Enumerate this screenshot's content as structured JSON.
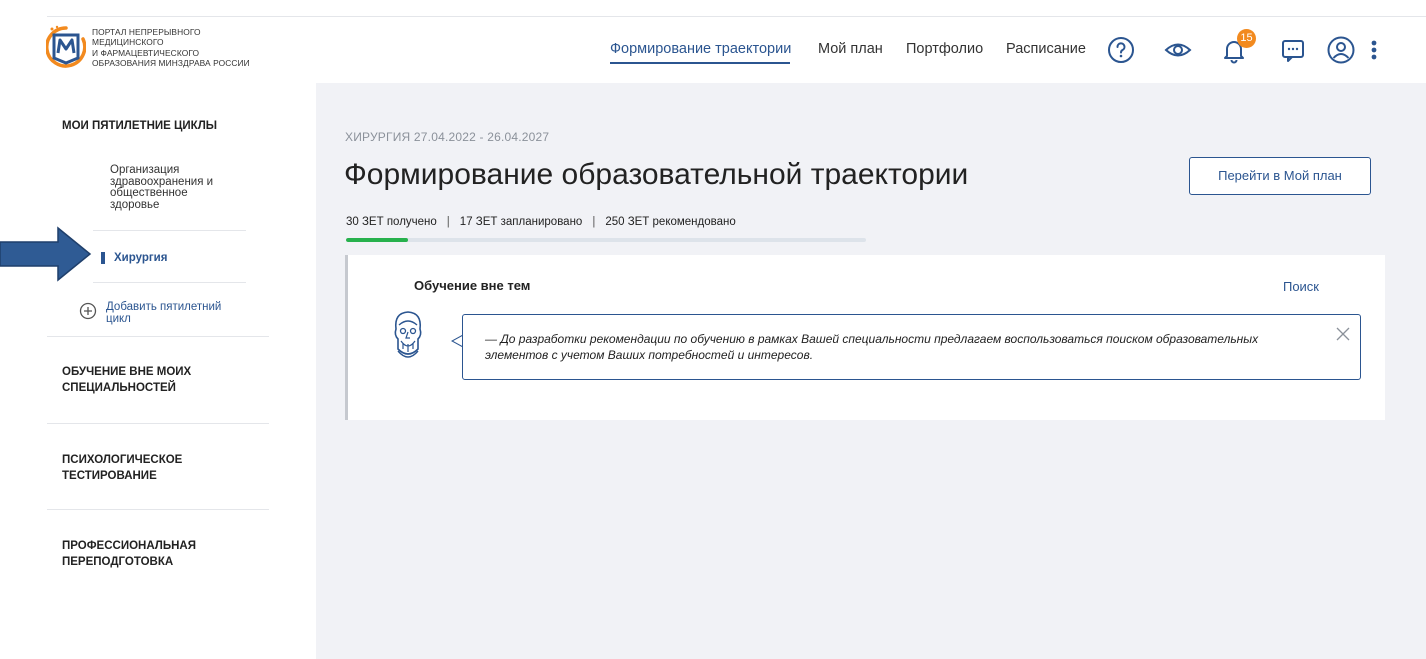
{
  "header": {
    "logo_lines": [
      "ПОРТАЛ НЕПРЕРЫВНОГО",
      "МЕДИЦИНСКОГО",
      "И ФАРМАЦЕВТИЧЕСКОГО",
      "ОБРАЗОВАНИЯ МИНЗДРАВА РОССИИ"
    ],
    "nav": {
      "trajectory": "Формирование траектории",
      "my_plan": "Мой план",
      "portfolio": "Портфолио",
      "schedule": "Расписание"
    },
    "notifications_count": "15",
    "accent_color": "#2b5590",
    "badge_color": "#f28a1f"
  },
  "sidebar": {
    "cycles_heading": "МОИ ПЯТИЛЕТНИЕ ЦИКЛЫ",
    "cycle_1_lines": [
      "Организация",
      "здравоохранения и",
      "общественное",
      "здоровье"
    ],
    "cycle_active": "Хирургия",
    "add_cycle_lines": [
      "Добавить пятилетний",
      "цикл"
    ],
    "section_2_lines": [
      "ОБУЧЕНИЕ ВНЕ МОИХ",
      "СПЕЦИАЛЬНОСТЕЙ"
    ],
    "section_3_lines": [
      "ПСИХОЛОГИЧЕСКОЕ",
      "ТЕСТИРОВАНИЕ"
    ],
    "section_4_lines": [
      "ПРОФЕССИОНАЛЬНАЯ",
      "ПЕРЕПОДГОТОВКА"
    ]
  },
  "main": {
    "breadcrumb": "ХИРУРГИЯ 27.04.2022 - 26.04.2027",
    "title": "Формирование образовательной траектории",
    "goto_button": "Перейти в Мой план",
    "stats": {
      "received": "30 ЗЕТ получено",
      "planned": "17 ЗЕТ запланировано",
      "recommended": "250 ЗЕТ рекомендовано",
      "separator": "|"
    },
    "progress_fraction": 0.12,
    "progress_color": "#27b14d",
    "card": {
      "title": "Обучение вне тем",
      "search_link": "Поиск",
      "message": "— До разработки рекомендации по обучению в рамках Вашей специальности предлагаем воспользоваться поиском образовательных элементов с учетом Ваших потребностей и интересов."
    }
  }
}
